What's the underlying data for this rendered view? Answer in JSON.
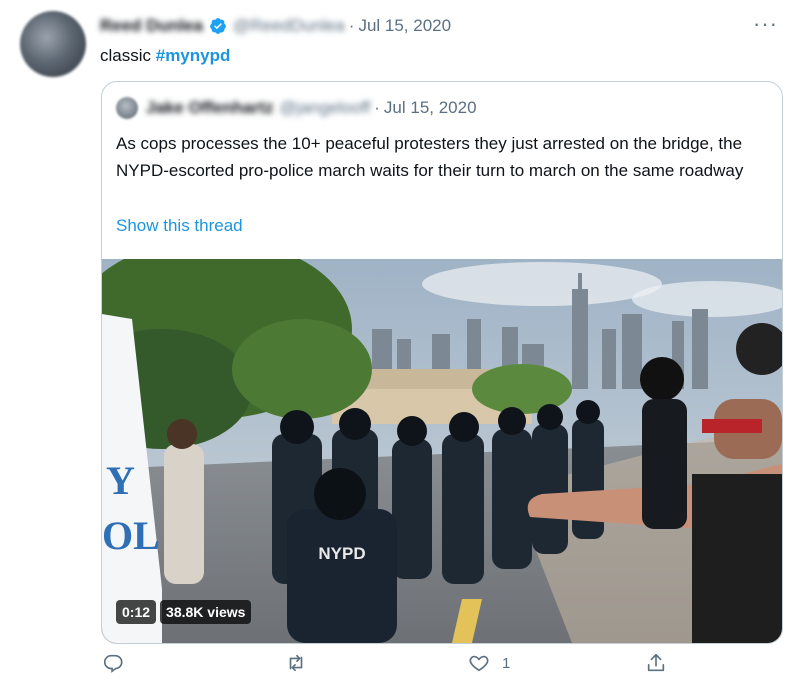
{
  "tweet": {
    "author_name": "Reed Dunlea",
    "author_handle": "@ReedDunlea",
    "separator": "·",
    "date": "Jul 15, 2020",
    "more_label": "···",
    "text_prefix": "classic ",
    "hashtag": "#mynypd"
  },
  "quoted_tweet": {
    "author_name": "Jake Offenhartz",
    "author_handle": "@jangelooff",
    "separator": "·",
    "date": "Jul 15, 2020",
    "text": "As cops processes the 10+ peaceful protesters they just arrested on the bridge, the NYPD-escorted pro-police march waits for their turn to march on the same roadway",
    "show_thread_label": "Show this thread",
    "video": {
      "duration": "0:12",
      "views": "38.8K views",
      "vest_text": "NYPD",
      "sign_text_1": "Y",
      "sign_text_2": "OL"
    }
  },
  "actions": {
    "reply_count": "",
    "retweet_count": "",
    "like_count": "1",
    "share_count": ""
  },
  "colors": {
    "link": "#1b95e0",
    "secondary_text": "#5b7083",
    "border": "#c4cfd6",
    "verified": "#1da1f2"
  }
}
